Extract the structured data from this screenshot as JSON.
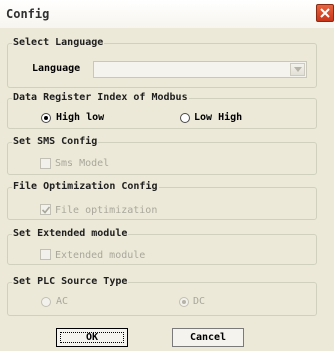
{
  "window": {
    "title": "Config"
  },
  "groups": {
    "language": {
      "label": "Select Language",
      "field_label": "Language",
      "selected": ""
    },
    "register": {
      "label": "Data Register Index of Modbus",
      "option_high_low": "High low",
      "option_low_high": "Low High",
      "selected": "High low"
    },
    "sms": {
      "label": "Set SMS Config",
      "checkbox_label": "Sms Model",
      "checked": false
    },
    "file_opt": {
      "label": "File Optimization Config",
      "checkbox_label": "File optimization",
      "checked": true
    },
    "ext_module": {
      "label": "Set Extended module",
      "checkbox_label": "Extended module",
      "checked": false
    },
    "plc": {
      "label": "Set PLC Source Type",
      "option_ac": "AC",
      "option_dc": "DC",
      "selected": "DC"
    }
  },
  "buttons": {
    "ok": "OK",
    "cancel": "Cancel"
  },
  "icons": {
    "close": "close-icon",
    "dropdown": "chevron-down-icon",
    "check": "check-icon"
  },
  "colors": {
    "close_button": "#d24a26",
    "dialog_bg": "#ece9d8",
    "disabled_text": "#a9a79a"
  }
}
